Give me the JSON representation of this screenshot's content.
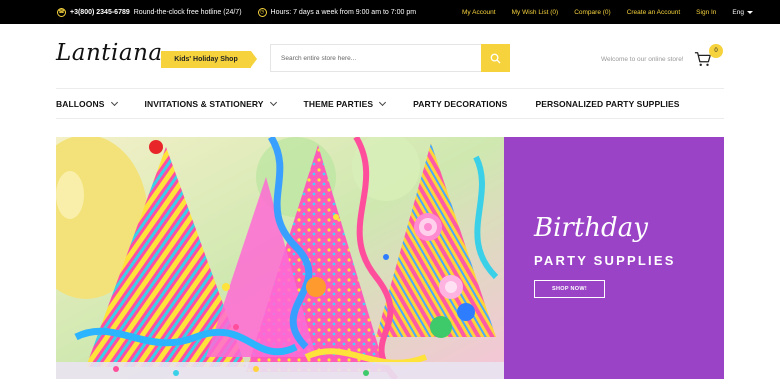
{
  "topbar": {
    "phone": "+3(800) 2345-6789",
    "hotline": "Round-the-clock free hotline (24/7)",
    "hours": "Hours: 7 days a week from 9:00 am to 7:00 pm",
    "links": [
      "My Account",
      "My Wish List (0)",
      "Compare (0)",
      "Create an Account",
      "Sign In"
    ],
    "language": "Eng",
    "accent_color": "#f6d33c"
  },
  "header": {
    "logo": "Lantiana",
    "tagline": "Kids' Holiday Shop",
    "search_placeholder": "Search entire store here...",
    "welcome": "Welcome to our online store!",
    "cart_count": "0"
  },
  "nav": {
    "items": [
      {
        "label": "BALLOONS",
        "has_dropdown": true
      },
      {
        "label": "INVITATIONS & STATIONERY",
        "has_dropdown": true
      },
      {
        "label": "THEME PARTIES",
        "has_dropdown": true
      },
      {
        "label": "PARTY DECORATIONS",
        "has_dropdown": false
      },
      {
        "label": "PERSONALIZED PARTY SUPPLIES",
        "has_dropdown": false
      }
    ]
  },
  "banner": {
    "title": "Birthday",
    "subtitle": "PARTY SUPPLIES",
    "button": "SHOP NOW!",
    "panel_color": "#9b43c7"
  }
}
